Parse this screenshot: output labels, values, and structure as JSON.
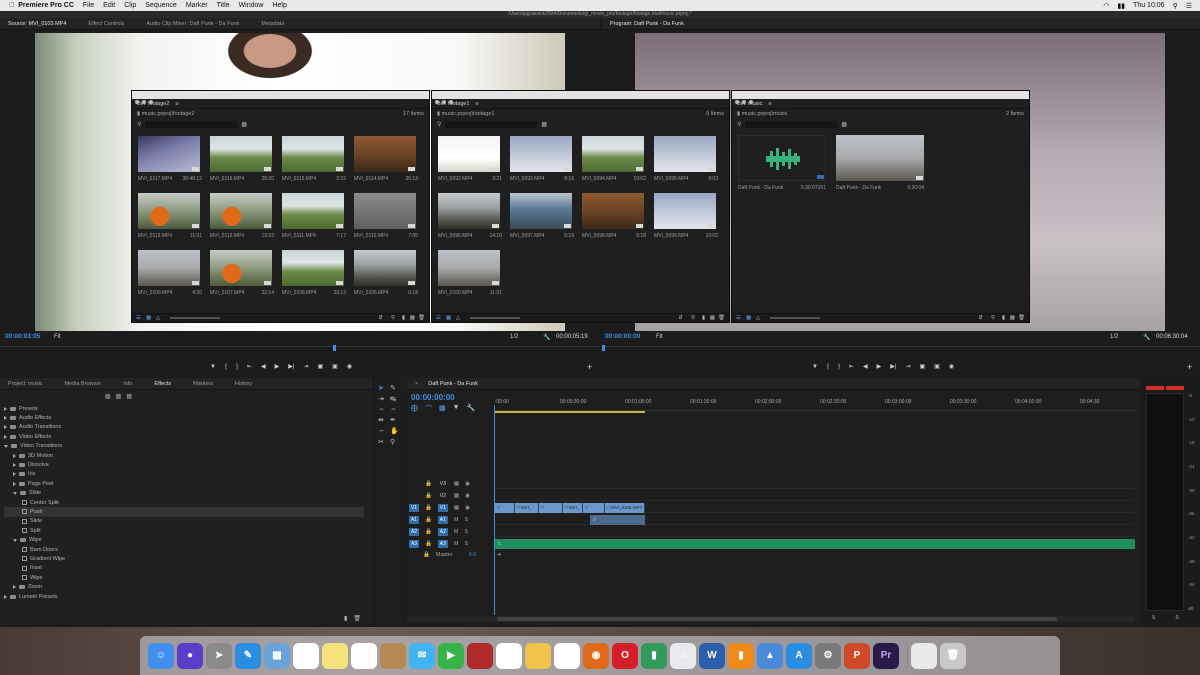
{
  "menubar": {
    "app": "Premiere Pro CC",
    "items": [
      "File",
      "Edit",
      "Clip",
      "Sequence",
      "Marker",
      "Title",
      "Window",
      "Help"
    ],
    "clock": "Thu 10:06"
  },
  "window_title": "/Users/pgrassick2504/Documents/gi_movie_pro/footage/footage trial/music.prproj *",
  "source_monitor": {
    "tabs": [
      "Source: MVI_0103.MP4",
      "Effect Controls",
      "Audio Clip Mixer: Daft Punk - Da Funk",
      "Metadata"
    ],
    "timecode": "00:00:03:05",
    "fit": "Fit",
    "ratio": "1/2",
    "duration": "00:00:05:19"
  },
  "program_monitor": {
    "tab": "Program: Daft Punk - Da Funk",
    "timecode": "00:00:00:00",
    "fit": "Fit",
    "ratio": "1/2",
    "duration": "00:06:30:04"
  },
  "bins": [
    {
      "title": "Bin: footage2",
      "path": "music.prproj\\footage2",
      "count": "17 Items",
      "clips": [
        {
          "name": "MVI_0117.MP4",
          "dur": "30:48:12",
          "look": "purple"
        },
        {
          "name": "MVI_0116.MP4",
          "dur": "28:20",
          "look": "park"
        },
        {
          "name": "MVI_0115.MP4",
          "dur": "2:22",
          "look": "park"
        },
        {
          "name": "MVI_0114.MP4",
          "dur": "35:13",
          "look": "brown"
        },
        {
          "name": "MVI_0113.MP4",
          "dur": "11:01",
          "look": "person"
        },
        {
          "name": "MVI_0112.MP4",
          "dur": "13:23",
          "look": "person"
        },
        {
          "name": "MVI_0111.MP4",
          "dur": "7:17",
          "look": "park"
        },
        {
          "name": "MVI_0110.MP4",
          "dur": "7:05",
          "look": "gray"
        },
        {
          "name": "MVI_0109.MP4",
          "dur": "4:20",
          "look": "trees"
        },
        {
          "name": "MVI_0107.MP4",
          "dur": "22:14",
          "look": "person"
        },
        {
          "name": "MVI_0108.MP4",
          "dur": "23:13",
          "look": "park"
        },
        {
          "name": "MVI_0105.MP4",
          "dur": "6:18",
          "look": "street"
        }
      ]
    },
    {
      "title": "Bin: footage1",
      "path": "music.prproj\\footage1",
      "count": "9 Items",
      "clips": [
        {
          "name": "MVI_0092.MP4",
          "dur": "3:21",
          "look": "bright"
        },
        {
          "name": "MVI_0093.MP4",
          "dur": "8:16",
          "look": "sky"
        },
        {
          "name": "MVI_0094.MP4",
          "dur": "10:02",
          "look": "park"
        },
        {
          "name": "MVI_0095.MP4",
          "dur": "9:03",
          "look": "sky"
        },
        {
          "name": "MVI_0096.MP4",
          "dur": "14:10",
          "look": "street"
        },
        {
          "name": "MVI_0097.MP4",
          "dur": "5:19",
          "look": "bus"
        },
        {
          "name": "MVI_0098.MP4",
          "dur": "6:18",
          "look": "brown"
        },
        {
          "name": "MVI_0099.MP4",
          "dur": "10:02",
          "look": "sky"
        },
        {
          "name": "MVI_0100.MP4",
          "dur": "11:01",
          "look": "trees"
        }
      ]
    },
    {
      "title": "Bin: music",
      "path": "music.prproj\\music",
      "count": "2 Items",
      "clips": [
        {
          "name": "Daft Punk - Da Funk",
          "dur": "5:30:07101",
          "look": "audio"
        },
        {
          "name": "Daft Punk - Da Funk",
          "dur": "5:30:04",
          "look": "trees"
        }
      ]
    }
  ],
  "effects_panel": {
    "tabs": [
      "Project: music",
      "Media Browser",
      "Info",
      "Effects",
      "Markers",
      "History"
    ],
    "tree": [
      {
        "label": "Presets",
        "level": 0,
        "type": "folder",
        "open": false
      },
      {
        "label": "Audio Effects",
        "level": 0,
        "type": "folder",
        "open": false
      },
      {
        "label": "Audio Transitions",
        "level": 0,
        "type": "folder",
        "open": false
      },
      {
        "label": "Video Effects",
        "level": 0,
        "type": "folder",
        "open": false
      },
      {
        "label": "Video Transitions",
        "level": 0,
        "type": "folder",
        "open": true
      },
      {
        "label": "3D Motion",
        "level": 1,
        "type": "folder",
        "open": false
      },
      {
        "label": "Dissolve",
        "level": 1,
        "type": "folder",
        "open": false
      },
      {
        "label": "Iris",
        "level": 1,
        "type": "folder",
        "open": false
      },
      {
        "label": "Page Peel",
        "level": 1,
        "type": "folder",
        "open": false
      },
      {
        "label": "Slide",
        "level": 1,
        "type": "folder",
        "open": true
      },
      {
        "label": "Center Split",
        "level": 2,
        "type": "fx"
      },
      {
        "label": "Push",
        "level": 2,
        "type": "fx",
        "selected": true
      },
      {
        "label": "Slide",
        "level": 2,
        "type": "fx"
      },
      {
        "label": "Split",
        "level": 2,
        "type": "fx"
      },
      {
        "label": "Wipe",
        "level": 1,
        "type": "folder",
        "open": true
      },
      {
        "label": "Barn Doors",
        "level": 2,
        "type": "fx"
      },
      {
        "label": "Gradient Wipe",
        "level": 2,
        "type": "fx"
      },
      {
        "label": "Inset",
        "level": 2,
        "type": "fx"
      },
      {
        "label": "Wipe",
        "level": 2,
        "type": "fx"
      },
      {
        "label": "Zoom",
        "level": 1,
        "type": "folder",
        "open": false
      },
      {
        "label": "Lumetri Presets",
        "level": 0,
        "type": "folder",
        "open": false
      }
    ]
  },
  "timeline": {
    "sequence": "Daft Punk - Da Funk",
    "timecode": "00:00:00:00",
    "ruler": [
      ":00:00",
      "00:00:30:00",
      "00:01:00:00",
      "00:01:30:00",
      "00:02:00:00",
      "00:02:30:00",
      "00:03:00:00",
      "00:03:30:00",
      "00:04:00:00",
      "00:04:30"
    ],
    "video_tracks": [
      "V3",
      "V2",
      "V1"
    ],
    "audio_tracks": [
      "A1",
      "A2",
      "A3"
    ],
    "master": "Master",
    "master_value": "0.0",
    "clip_labels": [
      "MVI_",
      "MVI_",
      "MVI_0106.MP4"
    ]
  },
  "audio_meter": {
    "scale": [
      "-6",
      "-12",
      "-18",
      "-24",
      "-30",
      "-36",
      "-42",
      "-48",
      "-54",
      "dB"
    ],
    "footer": [
      "S",
      "S"
    ]
  },
  "colors": {
    "accent_blue": "#3d8fe0",
    "clip_blue": "#5e8fc4",
    "audio_green": "#1f8f5d",
    "panel_bg": "#1f1f1f"
  }
}
